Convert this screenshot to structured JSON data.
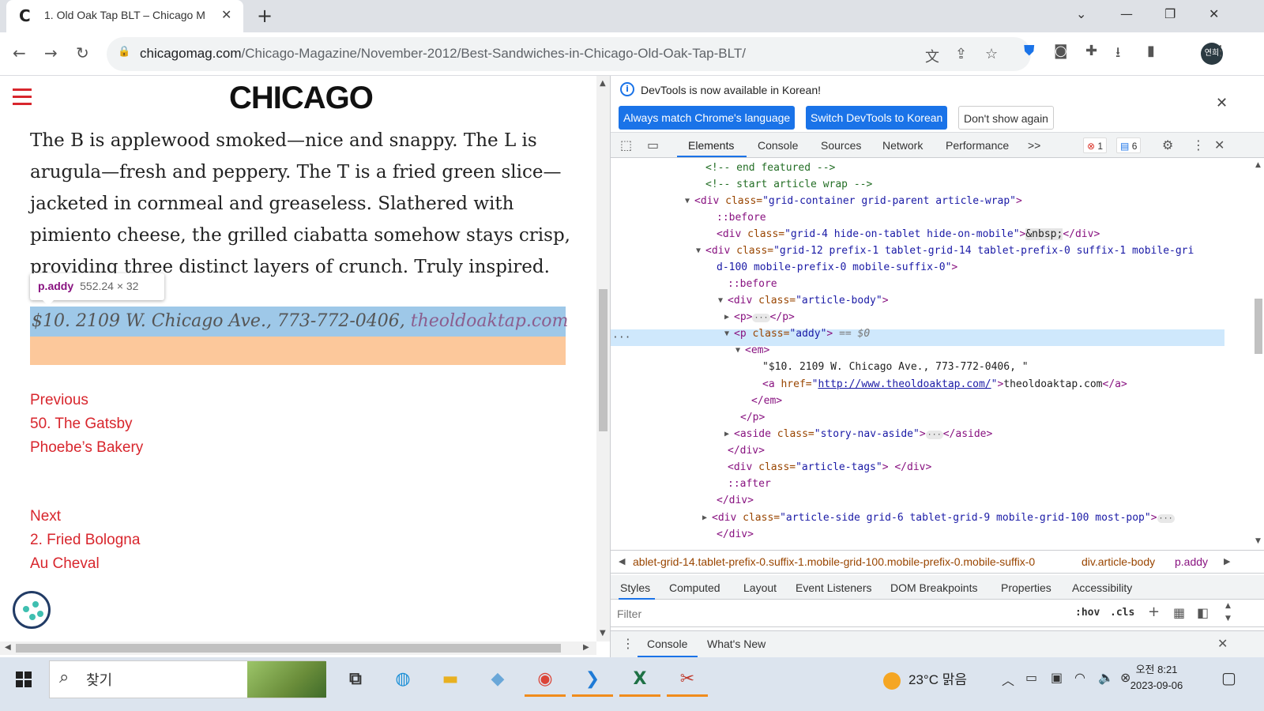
{
  "browser": {
    "tab_title": "1. Old Oak Tap BLT – Chicago M",
    "favicon_letter": "C",
    "new_tab_symbol": "+",
    "url_host": "chicagomag.com",
    "url_path": "/Chicago-Magazine/November-2012/Best-Sandwiches-in-Chicago-Old-Oak-Tap-BLT/",
    "avatar_text": "연희"
  },
  "page": {
    "logo": "CHICAGO",
    "body_text": "The B is applewood smoked—nice and snappy. The L is arugula—fresh and peppery. The T is a fried green slice—jacketed in cornmeal and greaseless. Slathered with pimiento cheese, the grilled ciabatta somehow stays crisp, providing three distinct layers of crunch. Truly inspired.",
    "tooltip_name": "p.addy",
    "tooltip_size": "552.24 × 32",
    "address_text": "$10. 2109 W. Chicago Ave., 773-772-0406, ",
    "address_link": "theoldoaktap.com",
    "prev_label": "Previous",
    "prev_title": "50. The Gatsby",
    "prev_place": "Phoebe’s Bakery",
    "next_label": "Next",
    "next_title": "2. Fried Bologna",
    "next_place": "Au Cheval"
  },
  "devtools": {
    "info_message": "DevTools is now available in Korean!",
    "btn_match": "Always match Chrome's language",
    "btn_switch": "Switch DevTools to Korean",
    "btn_dont": "Don't show again",
    "tabs": [
      "Elements",
      "Console",
      "Sources",
      "Network",
      "Performance"
    ],
    "more_tabs": ">>",
    "error_count": "1",
    "message_count": "6",
    "dom_lines": [
      {
        "comment": "<!-- end featured -->"
      },
      {
        "comment": "<!-- start article wrap -->"
      },
      {
        "tag_open": "<div ",
        "attr": "class=",
        "val": "\"grid-container grid-parent article-wrap\"",
        "close": ">"
      },
      {
        "pseudo": "::before"
      },
      {
        "tag_open": "<div ",
        "attr": "class=",
        "val": "\"grid-4 hide-on-tablet hide-on-mobile\"",
        "close": ">",
        "text": "&nbsp;",
        "end": "</div>"
      },
      {
        "tag_open": "<div ",
        "attr": "class=",
        "val": "\"grid-12 prefix-1 tablet-grid-14 tablet-prefix-0 suffix-1 mobile-gri",
        "close": ""
      },
      {
        "cont": "d-100 mobile-prefix-0 mobile-suffix-0\"",
        "close": ">"
      },
      {
        "pseudo": "::before"
      },
      {
        "tag_open": "<div ",
        "attr": "class=",
        "val": "\"article-body\"",
        "close": ">"
      },
      {
        "tag_open": "<p>",
        "ellipsis": "···",
        "end": "</p>"
      },
      {
        "tag_open": "<p ",
        "attr": "class=",
        "val": "\"addy\"",
        "close": ">",
        "marker": " == $0"
      },
      {
        "tag_open": "<em>"
      },
      {
        "string": "\"$10. 2109 W. Chicago Ave., 773-772-0406, \""
      },
      {
        "tag_open": "<a ",
        "attr": "href=",
        "link": "http://www.theoldoaktap.com/",
        "close": ">",
        "text": "theoldoaktap.com",
        "end": "</a>"
      },
      {
        "tag_open": "</em>"
      },
      {
        "tag_open": "</p>"
      },
      {
        "tag_open": "<aside ",
        "attr": "class=",
        "val": "\"story-nav-aside\"",
        "close": ">",
        "ellipsis": "···",
        "end": "</aside>"
      },
      {
        "tag_open": "</div>"
      },
      {
        "tag_open": "<div ",
        "attr": "class=",
        "val": "\"article-tags\"",
        "close": ">",
        "end": " </div>"
      },
      {
        "pseudo": "::after"
      },
      {
        "tag_open": "</div>"
      },
      {
        "tag_open": "<div ",
        "attr": "class=",
        "val": "\"article-side grid-6 tablet-grid-9 mobile-grid-100 most-pop\"",
        "close": ">",
        "ellipsis": "···"
      },
      {
        "tag_open": "</div>"
      }
    ],
    "crumbs": [
      "ablet-grid-14.tablet-prefix-0.suffix-1.mobile-grid-100.mobile-prefix-0.mobile-suffix-0",
      "div.article-body",
      "p.addy"
    ],
    "style_tabs": [
      "Styles",
      "Computed",
      "Layout",
      "Event Listeners",
      "DOM Breakpoints",
      "Properties",
      "Accessibility"
    ],
    "filter_placeholder": "Filter",
    "hov": ":hov",
    "cls": ".cls",
    "drawer_tabs": [
      "Console",
      "What's New"
    ]
  },
  "taskbar": {
    "search_placeholder": "찾기",
    "weather": "23°C  맑음",
    "time": "오전 8:21",
    "date": "2023-09-06"
  },
  "colors": {
    "accent_red": "#d8262d",
    "devtools_blue": "#1a73e8",
    "highlight_content": "#9ec8e8",
    "highlight_padding": "#fcc89b"
  }
}
